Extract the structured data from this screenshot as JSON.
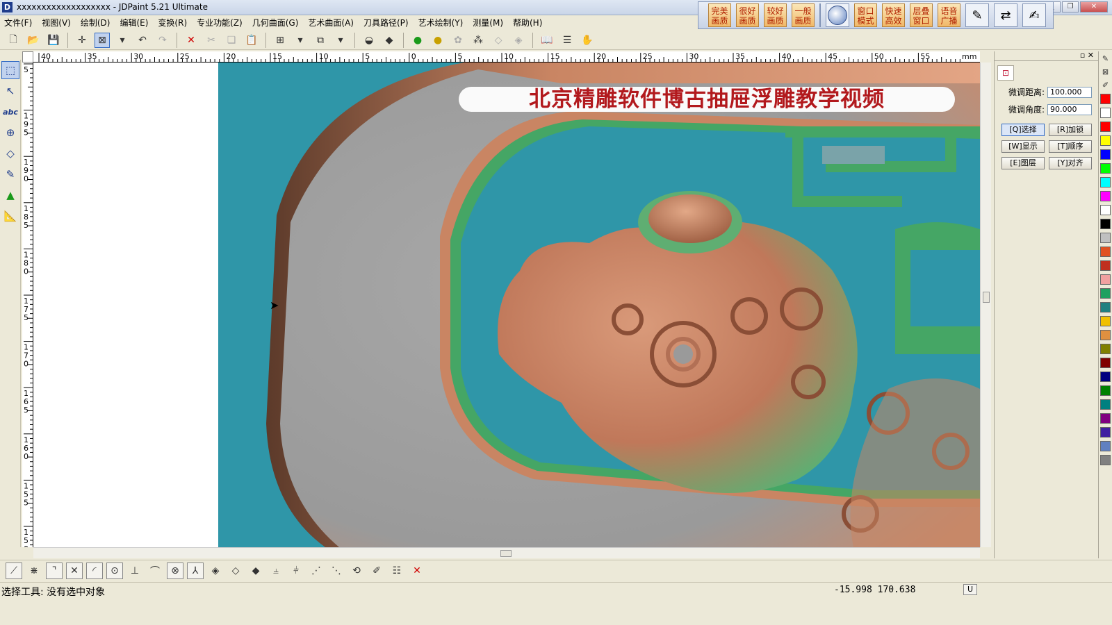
{
  "window": {
    "title": "xxxxxxxxxxxxxxxxxxx - JDPaint 5.21 Ultimate",
    "app_icon": "D",
    "buttons": [
      "_",
      "❐",
      "✕"
    ]
  },
  "quickbar": {
    "buttons": [
      {
        "label_1": "完美",
        "label_2": "画质"
      },
      {
        "label_1": "很好",
        "label_2": "画质"
      },
      {
        "label_1": "较好",
        "label_2": "画质"
      },
      {
        "label_1": "一般",
        "label_2": "画质"
      },
      {
        "label_1": "窗口",
        "label_2": "模式"
      },
      {
        "label_1": "快速",
        "label_2": "高效"
      },
      {
        "label_1": "层叠",
        "label_2": "窗口"
      },
      {
        "label_1": "语音",
        "label_2": "广播"
      }
    ]
  },
  "menu": [
    "文件(F)",
    "视图(V)",
    "绘制(D)",
    "编辑(E)",
    "变换(R)",
    "专业功能(Z)",
    "几何曲面(G)",
    "艺术曲面(A)",
    "刀具路径(P)",
    "艺术绘制(Y)",
    "测量(M)",
    "帮助(H)"
  ],
  "toolbar_icons": [
    "new-file-icon",
    "open-folder-icon",
    "save-icon",
    "crosshair-icon",
    "zoom-window-icon",
    "undo-icon",
    "redo-icon",
    "delete-icon",
    "cut-icon",
    "copy-icon",
    "paste-icon",
    "grid-icon",
    "layer-icon",
    "shade-icon",
    "mask-icon",
    "light-bulb-icon",
    "lamp-icon",
    "palette-icon",
    "nodes-icon",
    "eraser-icon",
    "fill-icon",
    "book-icon",
    "list-icon",
    "hand-icon"
  ],
  "ruler": {
    "unit": "mm",
    "h_labels": [
      "40",
      "35",
      "30",
      "25",
      "20",
      "15",
      "10",
      "5",
      "0",
      "5",
      "10",
      "15",
      "20",
      "25",
      "30",
      "35",
      "40",
      "45",
      "50",
      "55"
    ],
    "v_labels": [
      "5",
      "195",
      "190",
      "185",
      "180",
      "175",
      "170",
      "165",
      "160",
      "155",
      "150",
      "145"
    ]
  },
  "canvas": {
    "banner": "北京精雕软件博古抽屉浮雕教学视频"
  },
  "left_tools": [
    "select-icon",
    "node-edit-icon",
    "text-abc-icon",
    "transform-icon",
    "measure-icon",
    "pen-icon",
    "fill-bucket-icon",
    "ruler-measure-icon"
  ],
  "left_tools_text": {
    "abc": "abc"
  },
  "right_panel": {
    "dist_label": "微调距离:",
    "dist_value": "100.000",
    "angle_label": "微调角度:",
    "angle_value": "90.000",
    "buttons": [
      "[Q]选择",
      "[R]加锁",
      "[W]显示",
      "[T]顺序",
      "[E]图层",
      "[Y]对齐"
    ],
    "close_glyphs": "▫ ✕"
  },
  "palette_colors": [
    "#ff0000",
    "#ffffff",
    "#ff0000",
    "#ffff00",
    "#0000ff",
    "#00ff00",
    "#00ffff",
    "#ff00ff",
    "#ffffff",
    "#000000",
    "#c0c0c0",
    "#e05020",
    "#c03020",
    "#f0a0a0",
    "#20a060",
    "#208080",
    "#f0c000",
    "#e09040",
    "#808000",
    "#800000",
    "#000080",
    "#008000",
    "#008080",
    "#800080",
    "#4020a0",
    "#6080c0",
    "#808080"
  ],
  "status": {
    "text": "选择工具: 没有选中对象",
    "coords": "-15.998 170.638",
    "mode": "U"
  },
  "colors": {
    "relief_teal": "#2f96a8",
    "relief_copper": "#c98563",
    "relief_green": "#3fa460",
    "relief_gray": "#9c9c9c",
    "banner_red": "#b2191d"
  }
}
